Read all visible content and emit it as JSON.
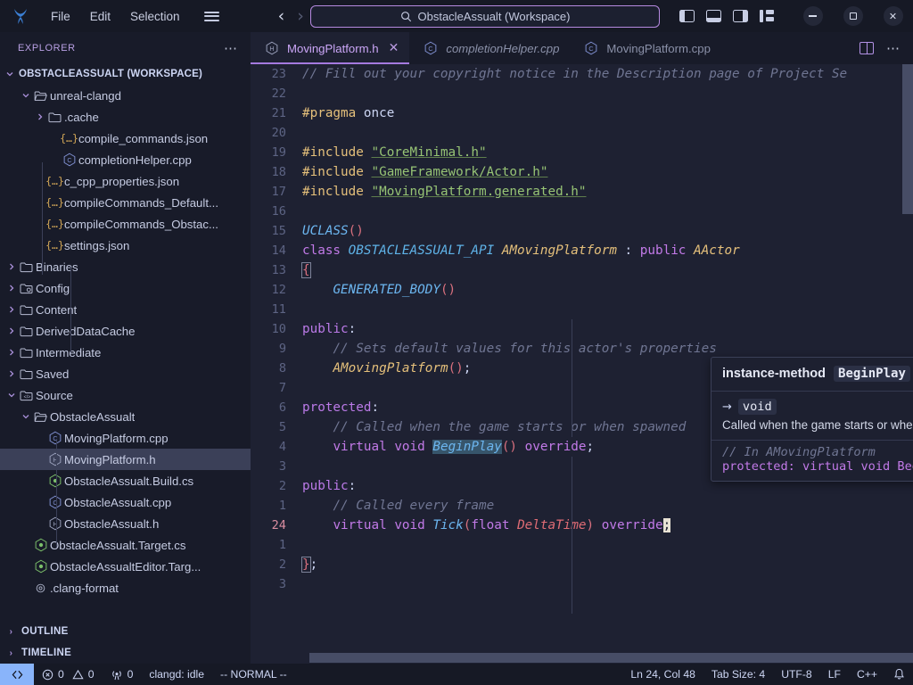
{
  "titlebar": {
    "logo_icon": "vscode-logo-icon",
    "menus": [
      "File",
      "Edit",
      "Selection"
    ],
    "hamburger_icon": "hamburger-menu-icon",
    "back_icon": "chevron-left-icon",
    "forward_icon": "chevron-right-icon",
    "command_center": {
      "search_icon": "search-icon",
      "text": "ObstacleAssualt (Workspace)"
    },
    "layout_icons": [
      "toggle-primary-sidebar-icon",
      "toggle-panel-icon",
      "toggle-secondary-sidebar-icon",
      "customize-layout-icon"
    ],
    "window_controls": {
      "minimize": "minimize-icon",
      "maximize": "maximize-icon",
      "close": "close-icon"
    }
  },
  "sidebar": {
    "title": "EXPLORER",
    "more_icon": "ellipsis-icon",
    "workspace": "OBSTACLEASSUALT (WORKSPACE)",
    "tree": [
      {
        "label": "unreal-clangd",
        "icon": "folder-open-icon",
        "chevron": "chevron-down",
        "indent": 2,
        "type": "folder"
      },
      {
        "label": ".cache",
        "icon": "folder-icon",
        "chevron": "chevron-right",
        "indent": 3,
        "type": "folder"
      },
      {
        "label": "compile_commands.json",
        "icon": "json-icon",
        "chevron": "",
        "indent": 4,
        "type": "json"
      },
      {
        "label": "completionHelper.cpp",
        "icon": "cpp-icon",
        "chevron": "",
        "indent": 4,
        "type": "cpp"
      },
      {
        "label": "c_cpp_properties.json",
        "icon": "json-icon",
        "chevron": "",
        "indent": 3,
        "type": "json"
      },
      {
        "label": "compileCommands_Default...",
        "icon": "json-icon",
        "chevron": "",
        "indent": 3,
        "type": "json"
      },
      {
        "label": "compileCommands_Obstac...",
        "icon": "json-icon",
        "chevron": "",
        "indent": 3,
        "type": "json"
      },
      {
        "label": "settings.json",
        "icon": "json-icon",
        "chevron": "",
        "indent": 3,
        "type": "json"
      },
      {
        "label": "Binaries",
        "icon": "folder-icon",
        "chevron": "chevron-right",
        "indent": 1,
        "type": "folder"
      },
      {
        "label": "Config",
        "icon": "folder-config-icon",
        "chevron": "chevron-right",
        "indent": 1,
        "type": "folder"
      },
      {
        "label": "Content",
        "icon": "folder-icon",
        "chevron": "chevron-right",
        "indent": 1,
        "type": "folder"
      },
      {
        "label": "DerivedDataCache",
        "icon": "folder-icon",
        "chevron": "chevron-right",
        "indent": 1,
        "type": "folder"
      },
      {
        "label": "Intermediate",
        "icon": "folder-icon",
        "chevron": "chevron-right",
        "indent": 1,
        "type": "folder"
      },
      {
        "label": "Saved",
        "icon": "folder-icon",
        "chevron": "chevron-right",
        "indent": 1,
        "type": "folder"
      },
      {
        "label": "Source",
        "icon": "folder-src-icon",
        "chevron": "chevron-down",
        "indent": 1,
        "type": "folder"
      },
      {
        "label": "ObstacleAssualt",
        "icon": "folder-open-icon",
        "chevron": "chevron-down",
        "indent": 2,
        "type": "folder"
      },
      {
        "label": "MovingPlatform.cpp",
        "icon": "cpp-icon",
        "chevron": "",
        "indent": 3,
        "type": "cpp"
      },
      {
        "label": "MovingPlatform.h",
        "icon": "header-icon",
        "chevron": "",
        "indent": 3,
        "type": "header",
        "selected": true
      },
      {
        "label": "ObstacleAssualt.Build.cs",
        "icon": "csharp-icon",
        "chevron": "",
        "indent": 3,
        "type": "cs"
      },
      {
        "label": "ObstacleAssualt.cpp",
        "icon": "cpp-icon",
        "chevron": "",
        "indent": 3,
        "type": "cpp"
      },
      {
        "label": "ObstacleAssualt.h",
        "icon": "header-icon",
        "chevron": "",
        "indent": 3,
        "type": "header"
      },
      {
        "label": "ObstacleAssualt.Target.cs",
        "icon": "csharp-icon",
        "chevron": "",
        "indent": 2,
        "type": "cs"
      },
      {
        "label": "ObstacleAssualtEditor.Targ...",
        "icon": "csharp-icon",
        "chevron": "",
        "indent": 2,
        "type": "cs"
      },
      {
        "label": ".clang-format",
        "icon": "gear-icon",
        "chevron": "",
        "indent": 2,
        "type": "config"
      }
    ],
    "panels": [
      {
        "label": "OUTLINE",
        "chevron": "chevron-right"
      },
      {
        "label": "TIMELINE",
        "chevron": "chevron-right"
      }
    ]
  },
  "editor": {
    "tabs": [
      {
        "label": "MovingPlatform.h",
        "icon": "header-icon",
        "active": true,
        "italic": false,
        "close_icon": "close-icon"
      },
      {
        "label": "completionHelper.cpp",
        "icon": "cpp-icon",
        "active": false,
        "italic": true
      },
      {
        "label": "MovingPlatform.cpp",
        "icon": "cpp-icon",
        "active": false,
        "italic": false
      }
    ],
    "actions": {
      "split_icon": "split-editor-icon",
      "more_icon": "ellipsis-icon"
    },
    "lines": [
      {
        "num": "23",
        "current": false
      },
      {
        "num": "22",
        "current": false
      },
      {
        "num": "21",
        "current": false
      },
      {
        "num": "20",
        "current": false
      },
      {
        "num": "19",
        "current": false
      },
      {
        "num": "18",
        "current": false
      },
      {
        "num": "17",
        "current": false
      },
      {
        "num": "16",
        "current": false
      },
      {
        "num": "15",
        "current": false
      },
      {
        "num": "14",
        "current": false
      },
      {
        "num": "13",
        "current": false
      },
      {
        "num": "12",
        "current": false
      },
      {
        "num": "11",
        "current": false
      },
      {
        "num": "10",
        "current": false
      },
      {
        "num": "9",
        "current": false
      },
      {
        "num": "8",
        "current": false
      },
      {
        "num": "7",
        "current": false
      },
      {
        "num": "6",
        "current": false
      },
      {
        "num": "5",
        "current": false
      },
      {
        "num": "4",
        "current": false
      },
      {
        "num": "3",
        "current": false
      },
      {
        "num": "2",
        "current": false
      },
      {
        "num": "1",
        "current": false
      },
      {
        "num": "24",
        "current": true
      },
      {
        "num": "1",
        "current": false
      },
      {
        "num": "2",
        "current": false
      },
      {
        "num": "3",
        "current": false
      }
    ],
    "source_text": [
      "// Fill out your copyright notice in the Description page of Project Se",
      "",
      "#pragma once",
      "",
      "#include \"CoreMinimal.h\"",
      "#include \"GameFramework/Actor.h\"",
      "#include \"MovingPlatform.generated.h\"",
      "",
      "UCLASS()",
      "class OBSTACLEASSUALT_API AMovingPlatform : public AActor",
      "{",
      "    GENERATED_BODY()",
      "",
      "public:",
      "    // Sets default values for this actor's properties",
      "    AMovingPlatform();",
      "",
      "protected:",
      "    // Called when the game starts or when spawned",
      "    virtual void BeginPlay() override;",
      "",
      "public:",
      "    // Called every frame",
      "    virtual void Tick(float DeltaTime) override;",
      "",
      "};",
      ""
    ]
  },
  "hover": {
    "kind": "instance-method",
    "symbol": "BeginPlay",
    "return_arrow": "→",
    "return_type": "void",
    "description": "Called when the game starts or when spawned",
    "source_comment": "// In AMovingPlatform",
    "source_signature": "protected: virtual void BeginPlay()"
  },
  "status": {
    "remote_icon": "remote-window-icon",
    "errors_icon": "error-icon",
    "errors": "0",
    "warnings_icon": "warning-icon",
    "warnings": "0",
    "ports_icon": "radio-tower-icon",
    "ports": "0",
    "clangd": "clangd: idle",
    "mode": "-- NORMAL --",
    "position": "Ln 24, Col 48",
    "tab_size": "Tab Size: 4",
    "encoding": "UTF-8",
    "eol": "LF",
    "language": "C++",
    "bell_icon": "bell-icon"
  }
}
